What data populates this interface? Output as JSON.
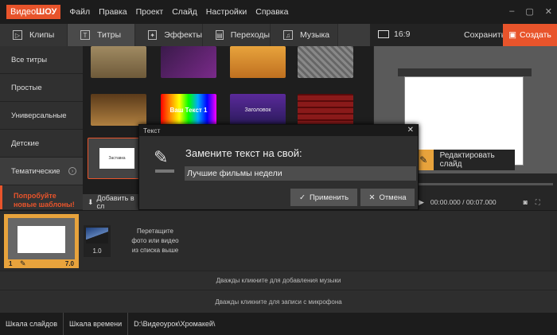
{
  "app": {
    "logo_a": "Видео",
    "logo_b": "ШОУ"
  },
  "menu": [
    "Файл",
    "Правка",
    "Проект",
    "Слайд",
    "Настройки",
    "Справка"
  ],
  "window_controls": [
    "–",
    "▢",
    "✕"
  ],
  "tabs": [
    {
      "label": "Клипы",
      "icon": "clips-icon",
      "glyph": "▷"
    },
    {
      "label": "Титры",
      "icon": "titles-icon",
      "glyph": "T"
    },
    {
      "label": "Эффекты",
      "icon": "effects-icon",
      "glyph": "✦"
    },
    {
      "label": "Переходы",
      "icon": "transitions-icon",
      "glyph": "▤"
    },
    {
      "label": "Музыка",
      "icon": "music-icon",
      "glyph": "♫"
    }
  ],
  "topright": {
    "ratio": "16:9",
    "save": "Сохранить",
    "create": "Создать"
  },
  "categories": [
    "Все титры",
    "Простые",
    "Универсальные",
    "Детские",
    "Тематические"
  ],
  "promo": [
    "Попробуйте",
    "новые шаблоны!"
  ],
  "thumb_texts": {
    "t1": "Ваш Текст 1",
    "t2": "Заголовок",
    "t3": "Заставка"
  },
  "add_label": "Добавить в сл",
  "edit_slide": "Редактировать слайд",
  "timecode": "00:00.000 / 00:07.000",
  "dialog": {
    "title": "Текст",
    "prompt": "Замените текст на свой:",
    "value": "Лучшие фильмы недели",
    "apply": "Применить",
    "cancel": "Отмена"
  },
  "strip": {
    "slide_num": "1",
    "slide_dur": "7.0",
    "transition_dur": "1.0",
    "hint": [
      "Перетащите",
      "фото или видео",
      "из списка выше"
    ]
  },
  "tracks": {
    "music": "Дважды кликните для добавления музыки",
    "mic": "Дважды кликните для записи с микрофона"
  },
  "statusbar": {
    "slides": "Шкала слайдов",
    "timeline": "Шкала времени",
    "path": "D:\\Видеоурок\\Хромакей\\"
  },
  "colors": {
    "accent": "#e8542b",
    "highlight": "#e8a33c"
  }
}
